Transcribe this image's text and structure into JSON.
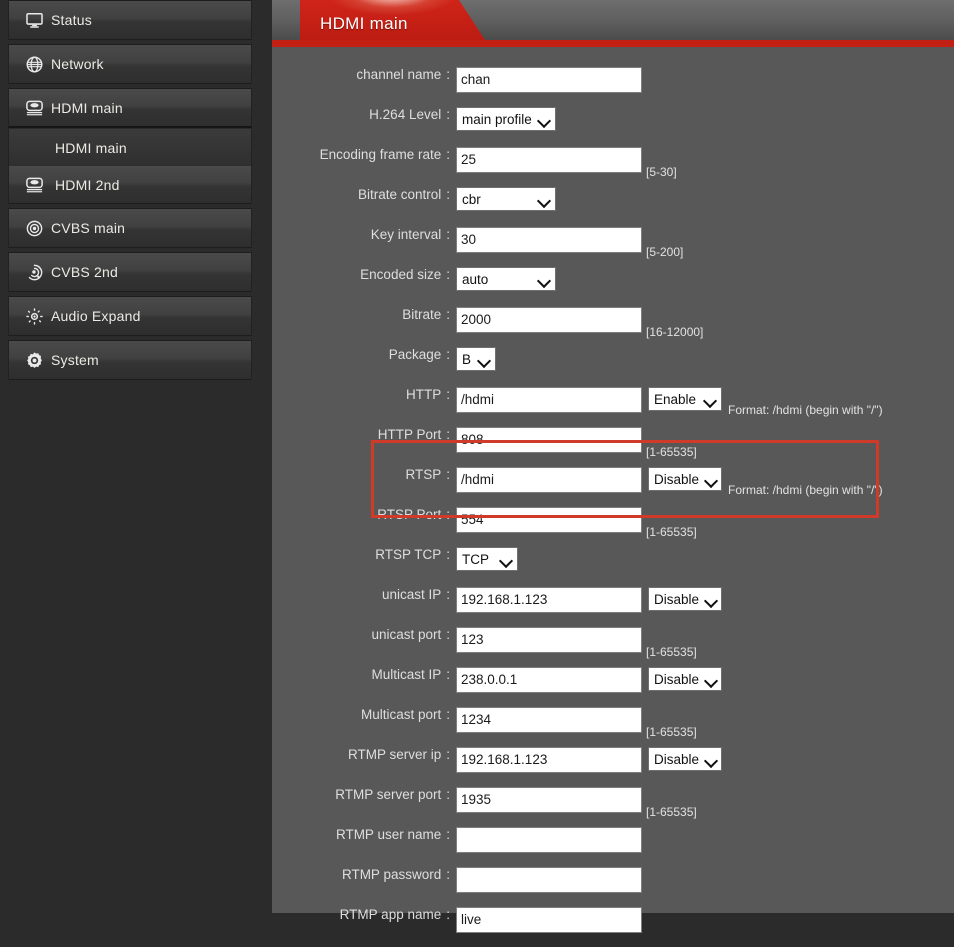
{
  "sidebar": {
    "items": [
      {
        "label": "Status",
        "icon": "monitor-icon",
        "type": "item",
        "name": "sidebar-item-status"
      },
      {
        "label": "Network",
        "icon": "globe-icon",
        "type": "item",
        "name": "sidebar-item-network"
      },
      {
        "label": "HDMI main",
        "icon": "encoder-icon",
        "type": "group",
        "name": "sidebar-group-hdmi-main"
      },
      {
        "label": "HDMI main",
        "icon": "",
        "type": "sub",
        "name": "sidebar-subitem-hdmi-main"
      },
      {
        "label": "HDMI 2nd",
        "icon": "encoder-icon",
        "type": "sub-last",
        "name": "sidebar-subitem-hdmi-2nd"
      },
      {
        "label": "CVBS main",
        "icon": "cvbs-icon",
        "type": "item",
        "name": "sidebar-item-cvbs-main"
      },
      {
        "label": "CVBS 2nd",
        "icon": "cvbs-2nd-icon",
        "type": "item",
        "name": "sidebar-item-cvbs-2nd"
      },
      {
        "label": "Audio Expand",
        "icon": "audio-expand-icon",
        "type": "item",
        "name": "sidebar-item-audio-expand"
      },
      {
        "label": "System",
        "icon": "gear-icon",
        "type": "item",
        "name": "sidebar-item-system"
      }
    ]
  },
  "tabs": [
    {
      "label": "HDMI main",
      "active": true
    }
  ],
  "form": {
    "rows": [
      {
        "label": "channel name",
        "colon": ":",
        "control": "input",
        "value": "chan",
        "hint": ""
      },
      {
        "label": "H.264 Level",
        "colon": ":",
        "control": "select",
        "value": "main profile",
        "hint": ""
      },
      {
        "label": "Encoding frame rate",
        "colon": ":",
        "control": "input",
        "value": "25",
        "hint": "[5-30]"
      },
      {
        "label": "Bitrate control",
        "colon": ":",
        "control": "select",
        "value": "cbr",
        "hint": ""
      },
      {
        "label": "Key interval",
        "colon": ":",
        "control": "input",
        "value": "30",
        "hint": "[5-200]"
      },
      {
        "label": "Encoded size",
        "colon": ":",
        "control": "select",
        "value": "auto",
        "hint": ""
      },
      {
        "label": "Bitrate",
        "colon": ":",
        "control": "input",
        "value": "2000",
        "hint": "[16-12000]"
      },
      {
        "label": "Package",
        "colon": ":",
        "control": "select-narrow",
        "value": "B",
        "hint": ""
      },
      {
        "label": "HTTP",
        "colon": ":",
        "control": "input-select",
        "value": "/hdmi",
        "side_value": "Enable",
        "hint": "Format: /hdmi (begin with \"/\")"
      },
      {
        "label": "HTTP Port",
        "colon": ":",
        "control": "input",
        "value": "808",
        "hint": "[1-65535]"
      },
      {
        "label": "RTSP",
        "colon": ":",
        "control": "input-select",
        "value": "/hdmi",
        "side_value": "Disable",
        "hint": "Format: /hdmi (begin with \"/\")"
      },
      {
        "label": "RTSP Port",
        "colon": ":",
        "control": "input",
        "value": "554",
        "hint": "[1-65535]"
      },
      {
        "label": "RTSP TCP",
        "colon": ":",
        "control": "select-small",
        "value": "TCP",
        "hint": ""
      },
      {
        "label": "unicast IP",
        "colon": ":",
        "control": "input-select",
        "value": "192.168.1.123",
        "side_value": "Disable",
        "hint": ""
      },
      {
        "label": "unicast port",
        "colon": ":",
        "control": "input",
        "value": "123",
        "hint": "[1-65535]"
      },
      {
        "label": "Multicast IP",
        "colon": ":",
        "control": "input-select",
        "value": "238.0.0.1",
        "side_value": "Disable",
        "hint": ""
      },
      {
        "label": "Multicast port",
        "colon": ":",
        "control": "input",
        "value": "1234",
        "hint": "[1-65535]"
      },
      {
        "label": "RTMP server ip",
        "colon": ":",
        "control": "input-select",
        "value": "192.168.1.123",
        "side_value": "Disable",
        "hint": ""
      },
      {
        "label": "RTMP server port",
        "colon": ":",
        "control": "input",
        "value": "1935",
        "hint": "[1-65535]"
      },
      {
        "label": "RTMP user name",
        "colon": ":",
        "control": "input",
        "value": "",
        "hint": ""
      },
      {
        "label": "RTMP password",
        "colon": ":",
        "control": "input",
        "value": "",
        "hint": ""
      },
      {
        "label": "RTMP app name",
        "colon": ":",
        "control": "input",
        "value": "live",
        "hint": ""
      }
    ]
  },
  "colors": {
    "accent_red": "#c32015",
    "tab_red": "#c41f14",
    "highlight_border": "#cf3b28",
    "panel_bg": "#585858",
    "sidebar_bg": "#2b2b2b",
    "field_bg": "#ffffff"
  }
}
